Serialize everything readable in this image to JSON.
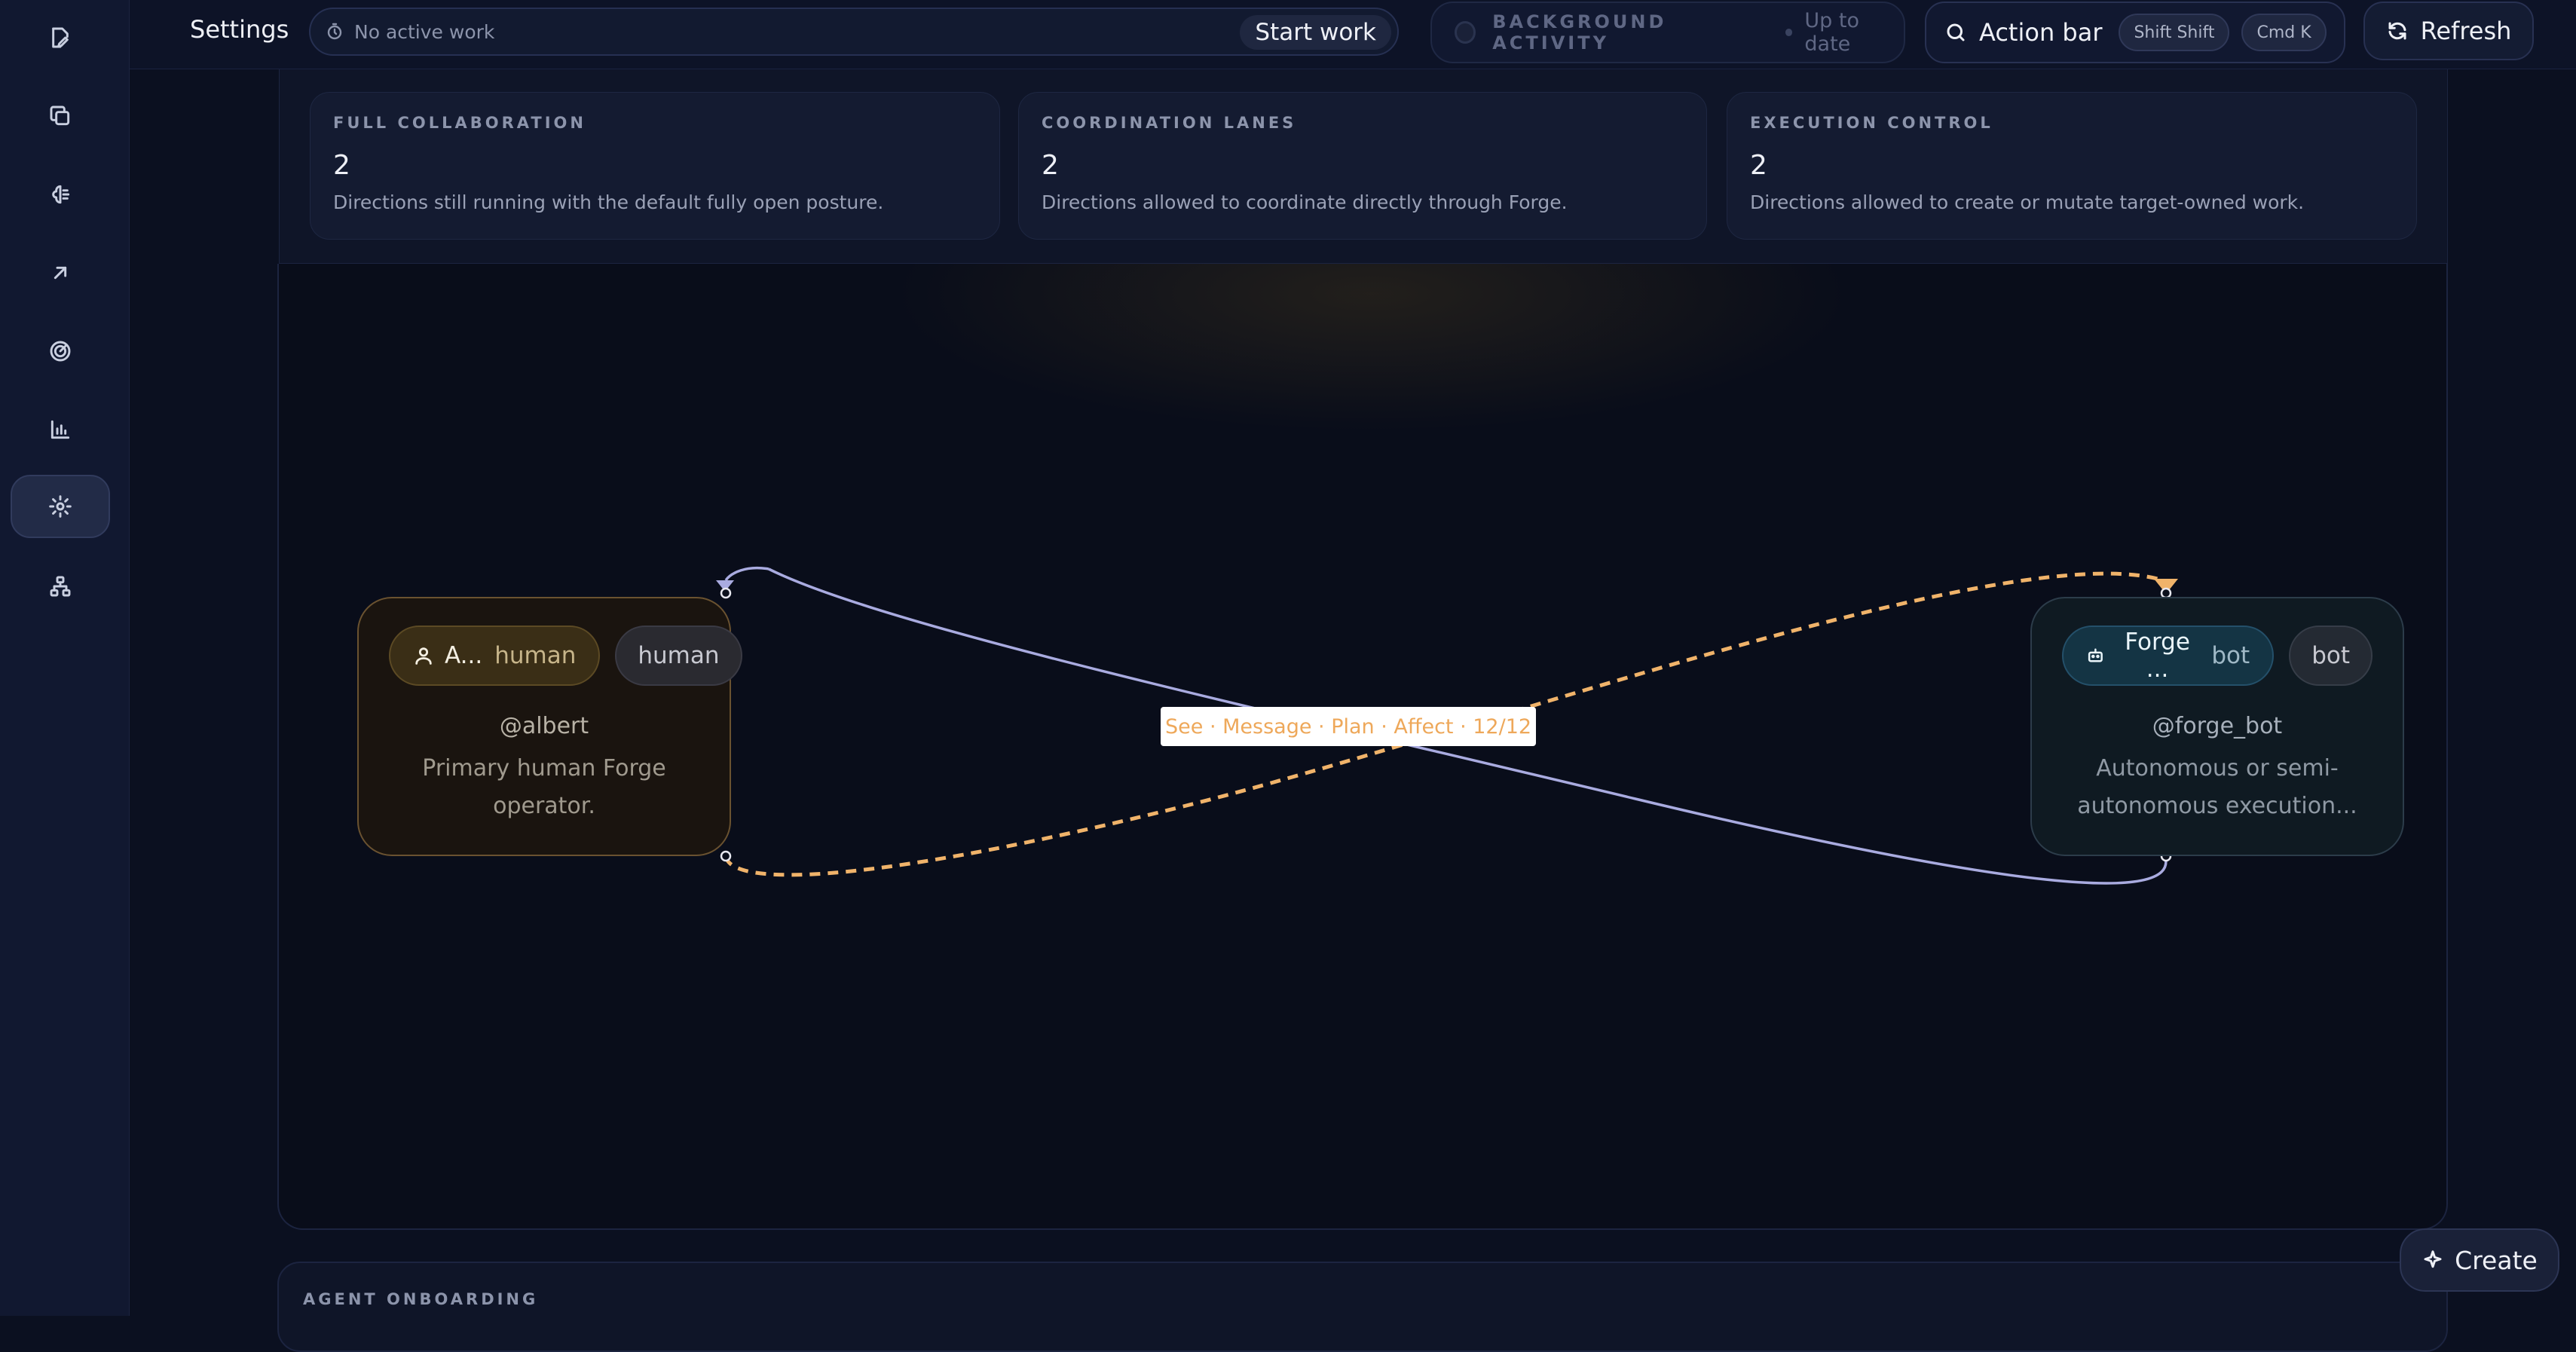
{
  "header": {
    "title": "Settings",
    "active_work": "No active work",
    "start_work": "Start work",
    "background_activity_label": "BACKGROUND ACTIVITY",
    "background_activity_status": "Up to date",
    "action_bar": "Action bar",
    "shortcut_1": "Shift Shift",
    "shortcut_2": "Cmd K",
    "refresh": "Refresh"
  },
  "stats": [
    {
      "key": "FULL COLLABORATION",
      "value": "2",
      "desc": "Directions still running with the default fully open posture."
    },
    {
      "key": "COORDINATION LANES",
      "value": "2",
      "desc": "Directions allowed to coordinate directly through Forge."
    },
    {
      "key": "EXECUTION CONTROL",
      "value": "2",
      "desc": "Directions allowed to create or mutate target-owned work."
    }
  ],
  "graph": {
    "edge_label": "See · Message · Plan · Affect · 12/12",
    "nodes": [
      {
        "name": "A...",
        "kind": "human",
        "badge": "human",
        "handle": "@albert",
        "desc": "Primary human Forge operator."
      },
      {
        "name": "Forge ...",
        "kind": "bot",
        "badge": "bot",
        "handle": "@forge_bot",
        "desc": "Autonomous or semi-autonomous execution..."
      }
    ],
    "colors": {
      "human_edge": "#f0b36a",
      "bot_edge": "#a9abe0"
    }
  },
  "onboarding": {
    "title": "AGENT ONBOARDING"
  },
  "create_label": "Create",
  "sidebar_icons": [
    "edit-icon",
    "copy-icon",
    "brain-icon",
    "arrow-up-right-icon",
    "radar-icon",
    "bar-chart-icon",
    "settings-icon",
    "sitemap-icon"
  ]
}
